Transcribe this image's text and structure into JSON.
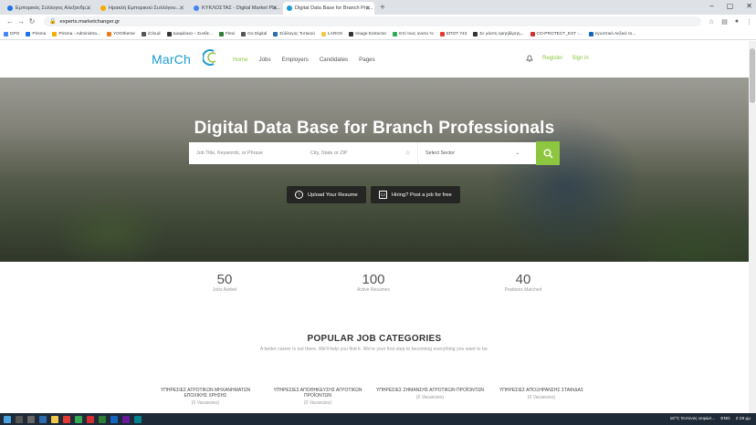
{
  "browser": {
    "tabs": [
      {
        "label": "Εμπορικός Σύλλογος Αλεξανδρ...",
        "color": "#1a73e8"
      },
      {
        "label": "Ηρακλή Εμπορικού Συλλόγου...",
        "color": "#f9ab00"
      },
      {
        "label": "ΚΥΚΛΟΣΤΑΣ - Digital Market Pla...",
        "color": "#4285f4"
      },
      {
        "label": "Digital Data Base for Branch Pro...",
        "color": "#1a9bd1"
      }
    ],
    "url": "experts.marketchanger.gr",
    "bookmarks": [
      "DPO",
      "Prisma",
      "Prisma - Administra...",
      "YOOtheme",
      "iCloud",
      "Διαφάνεια – Συνθε...",
      "Flexi",
      "Go Digital",
      "Σύλλογος Τυπικού",
      "LAROS",
      "Image Extractor",
      "Επί τους ανατο %",
      "ΕΠΟΤ 743",
      "Σε γάστη ηαηηδέρηη...",
      "CO-PROTECT_EXT -...",
      "Κρυπτικό Λεξικό το..."
    ]
  },
  "site": {
    "logo": "MarCh",
    "nav": [
      "Home",
      "Jobs",
      "Employers",
      "Candidates",
      "Pages"
    ],
    "register": "Register",
    "signin": "Sign in"
  },
  "hero": {
    "title": "Digital Data Base for Branch Professionals",
    "keyword_placeholder": "Job Title, Keywords, or Phrase",
    "city_placeholder": "City, State or ZIP",
    "sector_placeholder": "Select Sector",
    "upload_label": "Upload Your Resume",
    "hiring_label": "Hiring? Post a job for free"
  },
  "stats": [
    {
      "value": "50",
      "label": "Jobs Added"
    },
    {
      "value": "100",
      "label": "Active Resumes"
    },
    {
      "value": "40",
      "label": "Positions Matched"
    }
  ],
  "categories_section": {
    "title": "POPULAR JOB CATEGORIES",
    "subtitle": "A better career is out there. We'll help you find it. We're your first step to becoming everything you want to be.",
    "items": [
      {
        "name": "ΥΠΗΡΕΣΙΕΣ ΑΓΡΟΤΙΚΩΝ ΜΗΧΑΝΗΜΑΤΩΝ ΕΠΟΧΙΚΗΣ ΧΡΗΣΗΣ",
        "vacancies": "(0 Vacancies)"
      },
      {
        "name": "ΥΠΗΡΕΣΙΕΣ ΑΠΟΘΗΚΕΥΣΗΣ ΑΓΡΟΤΙΚΩΝ ΠΡΟΪΟΝΤΩΝ",
        "vacancies": "(0 Vacancies)"
      },
      {
        "name": "ΥΠΗΡΕΣΙΕΣ ΣΗΜΑΝΣΗΣ ΑΓΡΟΤΙΚΩΝ ΠΡΟΪΟΝΤΩΝ",
        "vacancies": "(0 Vacancies)"
      },
      {
        "name": "ΥΠΗΡΕΣΙΕΣ ΑΠΟΞΗΡΑΝΣΗΣ ΣΤΑΦΙΔΑΣ",
        "vacancies": "(0 Vacancies)"
      }
    ]
  },
  "taskbar": {
    "weather": "16°C Έντονος νεφώσ...",
    "lang": "ENG",
    "time": "2:19 μμ"
  },
  "colors": {
    "accent": "#8dc63f",
    "brand": "#1a9bd1"
  }
}
